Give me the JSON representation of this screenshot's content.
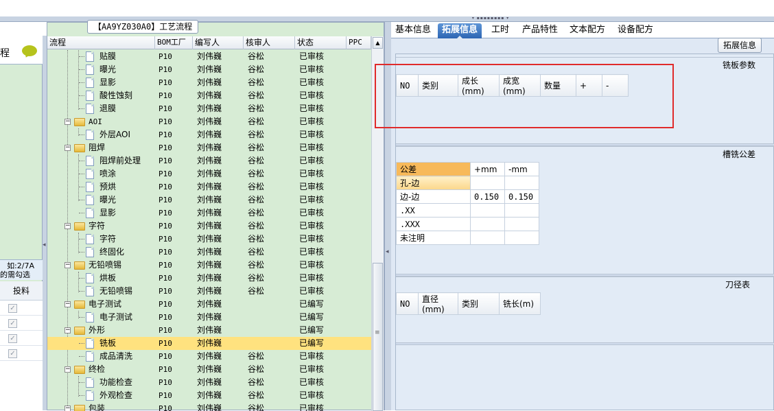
{
  "left": {
    "header_title": "程",
    "note_line1": "如:2/7A",
    "note_line2": "的需勾选",
    "column": "投料",
    "rows": [
      {
        "checked": "✓"
      },
      {
        "checked": "✓"
      },
      {
        "checked": "✓"
      },
      {
        "checked": "✓"
      }
    ]
  },
  "tree": {
    "title": "【AA9YZ030A0】工艺流程",
    "columns": {
      "flow": "流程",
      "plant": "BOM工厂",
      "writer": "编写人",
      "checker": "核审人",
      "status": "状态",
      "ppc": "PPC"
    },
    "rows": [
      {
        "label": "贴膜",
        "plant": "P10",
        "writer": "刘伟巍",
        "checker": "谷松",
        "status": "已审核"
      },
      {
        "label": "曝光",
        "plant": "P10",
        "writer": "刘伟巍",
        "checker": "谷松",
        "status": "已审核"
      },
      {
        "label": "显影",
        "plant": "P10",
        "writer": "刘伟巍",
        "checker": "谷松",
        "status": "已审核"
      },
      {
        "label": "酸性蚀刻",
        "plant": "P10",
        "writer": "刘伟巍",
        "checker": "谷松",
        "status": "已审核"
      },
      {
        "label": "退膜",
        "plant": "P10",
        "writer": "刘伟巍",
        "checker": "谷松",
        "status": "已审核"
      },
      {
        "label": "AOI",
        "plant": "P10",
        "writer": "刘伟巍",
        "checker": "谷松",
        "status": "已审核"
      },
      {
        "label": "外层AOI",
        "plant": "P10",
        "writer": "刘伟巍",
        "checker": "谷松",
        "status": "已审核"
      },
      {
        "label": "阻焊",
        "plant": "P10",
        "writer": "刘伟巍",
        "checker": "谷松",
        "status": "已审核"
      },
      {
        "label": "阻焊前处理",
        "plant": "P10",
        "writer": "刘伟巍",
        "checker": "谷松",
        "status": "已审核"
      },
      {
        "label": "喷涂",
        "plant": "P10",
        "writer": "刘伟巍",
        "checker": "谷松",
        "status": "已审核"
      },
      {
        "label": "预烘",
        "plant": "P10",
        "writer": "刘伟巍",
        "checker": "谷松",
        "status": "已审核"
      },
      {
        "label": "曝光",
        "plant": "P10",
        "writer": "刘伟巍",
        "checker": "谷松",
        "status": "已审核"
      },
      {
        "label": "显影",
        "plant": "P10",
        "writer": "刘伟巍",
        "checker": "谷松",
        "status": "已审核"
      },
      {
        "label": "字符",
        "plant": "P10",
        "writer": "刘伟巍",
        "checker": "谷松",
        "status": "已审核"
      },
      {
        "label": "字符",
        "plant": "P10",
        "writer": "刘伟巍",
        "checker": "谷松",
        "status": "已审核"
      },
      {
        "label": "终固化",
        "plant": "P10",
        "writer": "刘伟巍",
        "checker": "谷松",
        "status": "已审核"
      },
      {
        "label": "无铅喷锡",
        "plant": "P10",
        "writer": "刘伟巍",
        "checker": "谷松",
        "status": "已审核"
      },
      {
        "label": "烘板",
        "plant": "P10",
        "writer": "刘伟巍",
        "checker": "谷松",
        "status": "已审核"
      },
      {
        "label": "无铅喷锡",
        "plant": "P10",
        "writer": "刘伟巍",
        "checker": "谷松",
        "status": "已审核"
      },
      {
        "label": "电子测试",
        "plant": "P10",
        "writer": "刘伟巍",
        "checker": "",
        "status": "已编写"
      },
      {
        "label": "电子测试",
        "plant": "P10",
        "writer": "刘伟巍",
        "checker": "",
        "status": "已编写"
      },
      {
        "label": "外形",
        "plant": "P10",
        "writer": "刘伟巍",
        "checker": "",
        "status": "已编写"
      },
      {
        "label": "铣板",
        "plant": "P10",
        "writer": "刘伟巍",
        "checker": "",
        "status": "已编写"
      },
      {
        "label": "成品清洗",
        "plant": "P10",
        "writer": "刘伟巍",
        "checker": "谷松",
        "status": "已审核"
      },
      {
        "label": "终检",
        "plant": "P10",
        "writer": "刘伟巍",
        "checker": "谷松",
        "status": "已审核"
      },
      {
        "label": "功能检查",
        "plant": "P10",
        "writer": "刘伟巍",
        "checker": "谷松",
        "status": "已审核"
      },
      {
        "label": "外观检查",
        "plant": "P10",
        "writer": "刘伟巍",
        "checker": "谷松",
        "status": "已审核"
      },
      {
        "label": "包装",
        "plant": "P10",
        "writer": "刘伟巍",
        "checker": "谷松",
        "status": "已审核"
      }
    ]
  },
  "tabs": [
    "基本信息",
    "拓展信息",
    "工时",
    "产品特性",
    "文本配方",
    "设备配方"
  ],
  "active_tab": "拓展信息",
  "ext_button": "拓展信息",
  "milling": {
    "title": "铣板参数",
    "headers": [
      "NO",
      "类别",
      "成长(mm)",
      "成宽(mm)",
      "数量",
      "+",
      "-"
    ]
  },
  "tolerance": {
    "title": "槽铣公差",
    "headers": [
      "公差",
      "+mm",
      "-mm"
    ],
    "rows": [
      {
        "name": "孔-边",
        "plus": "",
        "minus": ""
      },
      {
        "name": "边-边",
        "plus": "0.150",
        "minus": "0.150"
      },
      {
        "name": ".XX",
        "plus": "",
        "minus": ""
      },
      {
        "name": ".XXX",
        "plus": "",
        "minus": ""
      },
      {
        "name": "未注明",
        "plus": "",
        "minus": ""
      }
    ]
  },
  "tools": {
    "title": "刀径表",
    "headers": [
      "NO",
      "直径(mm)",
      "类别",
      "铣长(m)"
    ]
  },
  "colors": {
    "tree_bg": "#d7ecd5",
    "selected_row": "#ffe27f",
    "highlight_box": "#e02a2a",
    "active_tab": "#2c65b3"
  }
}
